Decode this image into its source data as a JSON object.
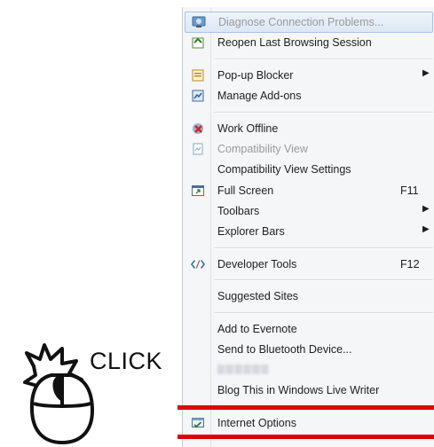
{
  "menu": {
    "items": [
      {
        "label": "Diagnose Connection Problems...",
        "icon": "diagnose-icon",
        "disabled": true
      },
      {
        "label": "Reopen Last Browsing Session",
        "icon": "reopen-session-icon"
      },
      {
        "label": "Pop-up Blocker",
        "icon": "popup-blocker-icon",
        "submenu": true
      },
      {
        "label": "Manage Add-ons",
        "icon": "addons-icon"
      },
      {
        "label": "Work Offline",
        "icon": "work-offline-icon"
      },
      {
        "label": "Compatibility View",
        "icon": "compatibility-view-icon",
        "disabled": true
      },
      {
        "label": "Compatibility View Settings"
      },
      {
        "label": "Full Screen",
        "icon": "full-screen-icon",
        "shortcut": "F11"
      },
      {
        "label": "Toolbars",
        "submenu": true
      },
      {
        "label": "Explorer Bars",
        "submenu": true
      },
      {
        "label": "Developer Tools",
        "icon": "developer-tools-icon",
        "shortcut": "F12"
      },
      {
        "label": "Suggested Sites"
      },
      {
        "label": "Add to Evernote"
      },
      {
        "label": "Send to Bluetooth Device..."
      },
      {
        "label": "",
        "blurred": true
      },
      {
        "label": "Blog This in Windows Live Writer"
      },
      {
        "label": "Internet Options",
        "icon": "internet-options-icon"
      }
    ],
    "submenu_arrow": "▶"
  },
  "annotation": {
    "click_text": "CLICK",
    "highlight_color": "#e00000"
  }
}
